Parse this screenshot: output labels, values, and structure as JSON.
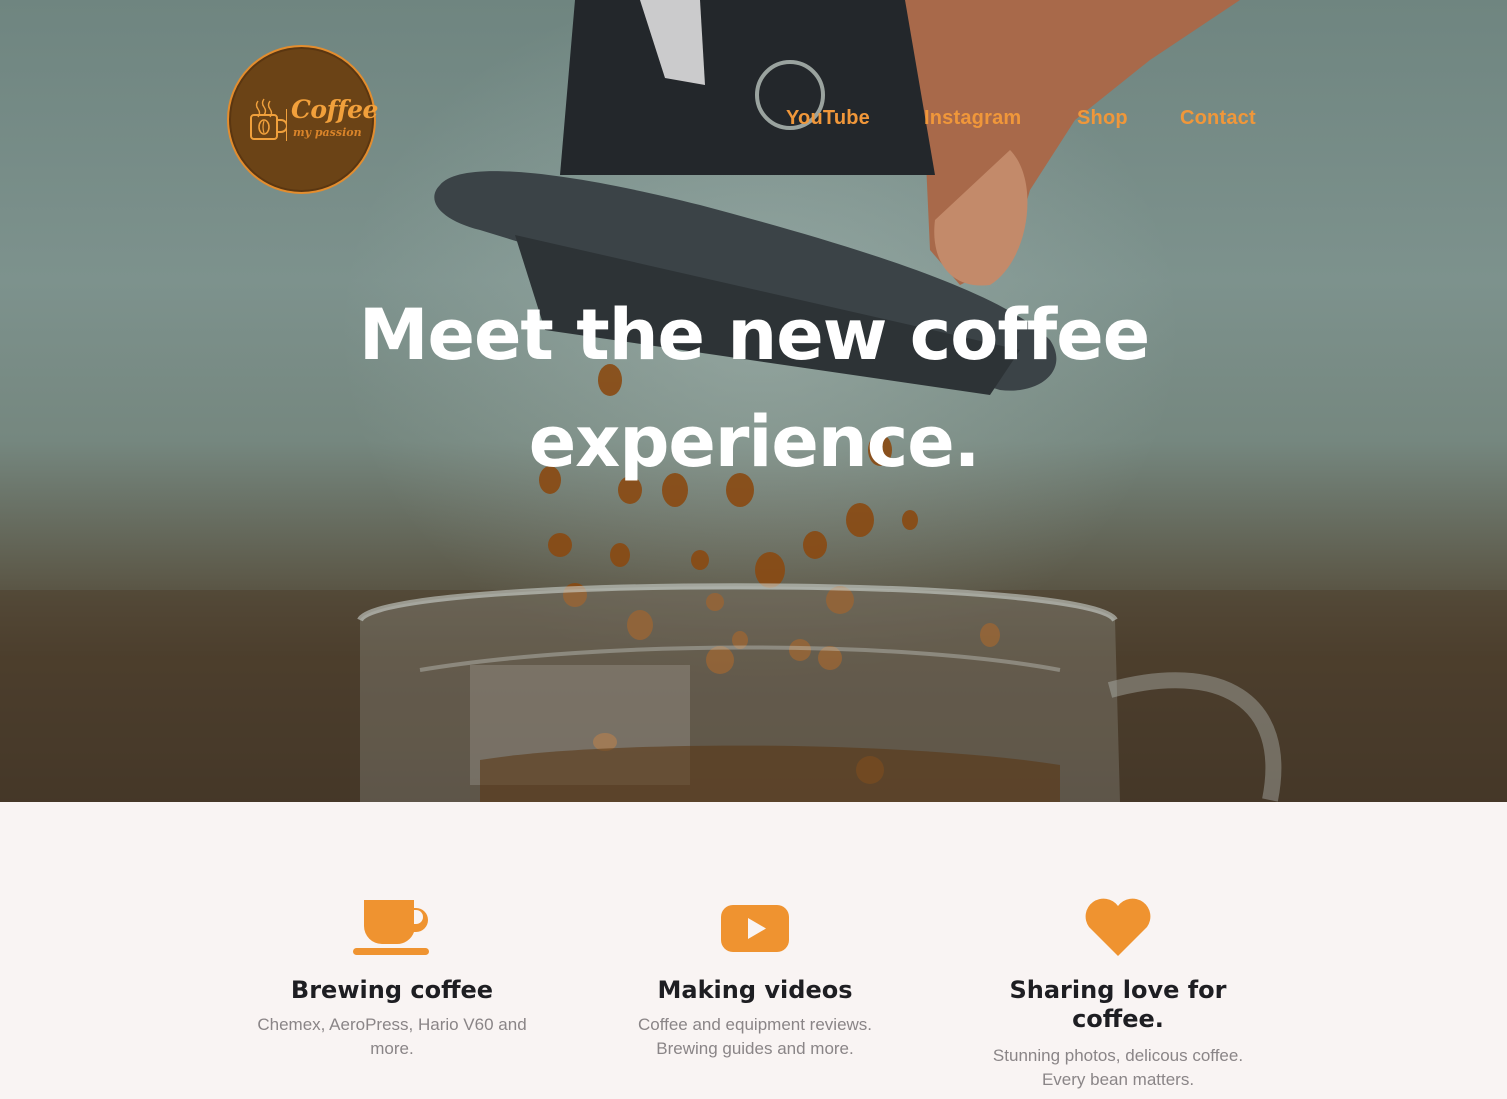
{
  "logo": {
    "word": "Coffee",
    "sub": "my passion"
  },
  "nav": {
    "items": [
      {
        "label": "YouTube"
      },
      {
        "label": "Instagram"
      },
      {
        "label": "Shop"
      },
      {
        "label": "Contact"
      }
    ]
  },
  "hero": {
    "title": "Meet the new coffee experience."
  },
  "features": [
    {
      "icon": "coffee-cup-icon",
      "title": "Brewing coffee",
      "text": "Chemex, AeroPress, Hario V60 and more."
    },
    {
      "icon": "video-play-icon",
      "title": "Making videos",
      "text": "Coffee and equipment reviews. Brewing guides and more."
    },
    {
      "icon": "heart-icon",
      "title": "Sharing love for coffee.",
      "text": "Stunning photos, delicous coffee. Every bean matters."
    }
  ],
  "colors": {
    "accent": "#ef9330",
    "heading": "#1e1e22",
    "body_text": "#8a8587",
    "section_bg": "#f9f4f3",
    "logo_bg": "#6b4316"
  }
}
